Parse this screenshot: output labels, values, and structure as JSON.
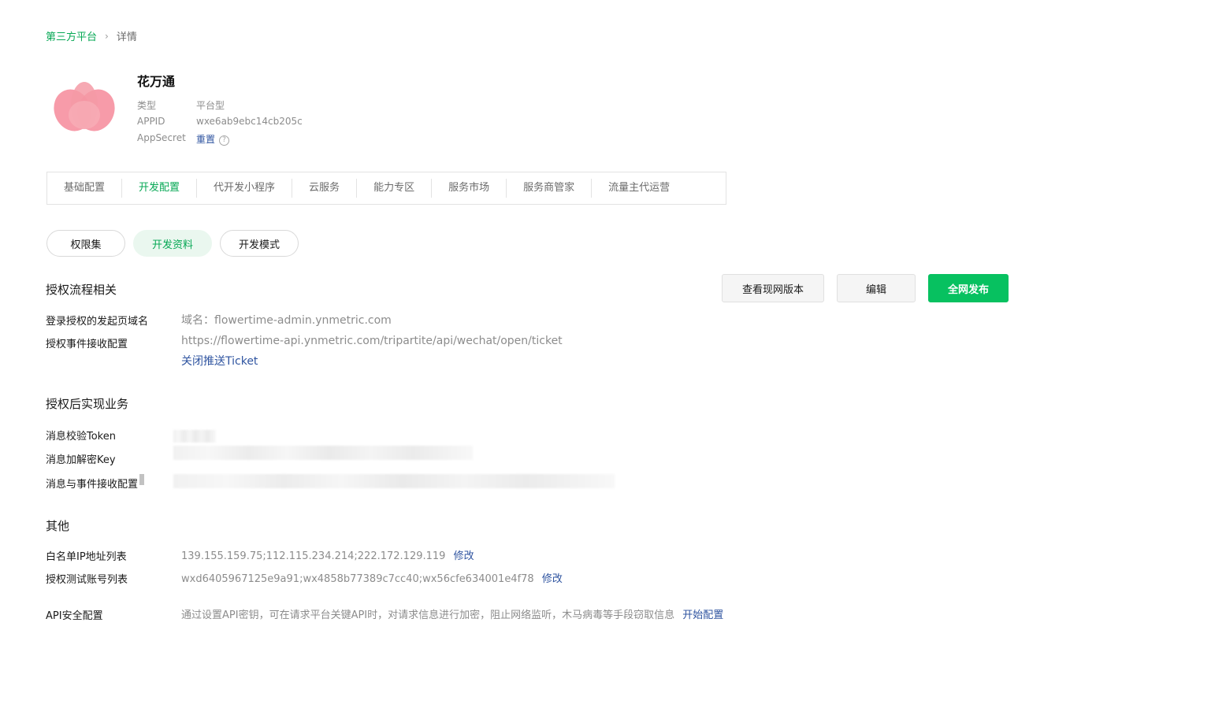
{
  "breadcrumb": {
    "root": "第三方平台",
    "separator": "›",
    "current": "详情"
  },
  "app": {
    "name": "花万通",
    "logo_icon": "lotus-logo",
    "brand_color": "#f47a8c",
    "type_label": "类型",
    "type_value": "平台型",
    "appid_label": "APPID",
    "appid_value": "wxe6ab9ebc14cb205c",
    "secret_label": "AppSecret",
    "secret_action": "重置",
    "help_icon": "?"
  },
  "tabs": [
    {
      "label": "基础配置"
    },
    {
      "label": "开发配置",
      "active": true
    },
    {
      "label": "代开发小程序"
    },
    {
      "label": "云服务"
    },
    {
      "label": "能力专区"
    },
    {
      "label": "服务市场"
    },
    {
      "label": "服务商管家"
    },
    {
      "label": "流量主代运营"
    }
  ],
  "subtabs": [
    {
      "label": "权限集"
    },
    {
      "label": "开发资料",
      "active": true
    },
    {
      "label": "开发模式"
    }
  ],
  "actions": {
    "view_version": "查看现网版本",
    "edit": "编辑",
    "publish": "全网发布"
  },
  "auth_flow": {
    "title": "授权流程相关",
    "login_domain_label": "登录授权的发起页域名",
    "login_domain_value": "域名：flowertime-admin.ynmetric.com",
    "event_label": "授权事件接收配置",
    "event_value": "https://flowertime-api.ynmetric.com/tripartite/api/wechat/open/ticket",
    "event_action": "关闭推送Ticket"
  },
  "business": {
    "title": "授权后实现业务",
    "token_label": "消息校验Token",
    "key_label": "消息加解密Key",
    "msg_config_label": "消息与事件接收配置"
  },
  "other": {
    "title": "其他",
    "ip_label": "白名单IP地址列表",
    "ip_value": "139.155.159.75;112.115.234.214;222.172.129.119",
    "ip_action": "修改",
    "test_label": "授权测试账号列表",
    "test_value": "wxd6405967125e9a91;wx4858b77389c7cc40;wx56cfe634001e4f78",
    "test_action": "修改",
    "api_label": "API安全配置",
    "api_value": "通过设置API密钥，可在请求平台关键API时，对请求信息进行加密，阻止网络监听，木马病毒等手段窃取信息",
    "api_action": "开始配置"
  },
  "colors": {
    "accent": "#07c160",
    "accent_text": "#07a855",
    "link": "#2f54a0"
  }
}
